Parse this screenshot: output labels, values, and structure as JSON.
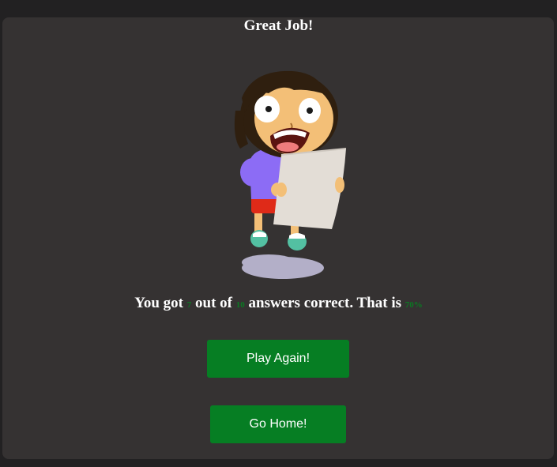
{
  "result": {
    "title": "Great Job!",
    "line_prefix": "You got",
    "correct_count": "7",
    "line_mid": "out of",
    "total_count": "10",
    "line_suffix": "answers correct. That is",
    "percentage": "70%"
  },
  "actions": {
    "play_again_label": "Play Again!",
    "go_home_label": "Go Home!"
  },
  "colors": {
    "background": "#222122",
    "card": "#353232",
    "accent_green": "#067e23",
    "number_green": "#0a7a22",
    "text": "#ffffff"
  },
  "icons": {
    "illustration": "shocked-girl-reading-paper-illustration"
  }
}
